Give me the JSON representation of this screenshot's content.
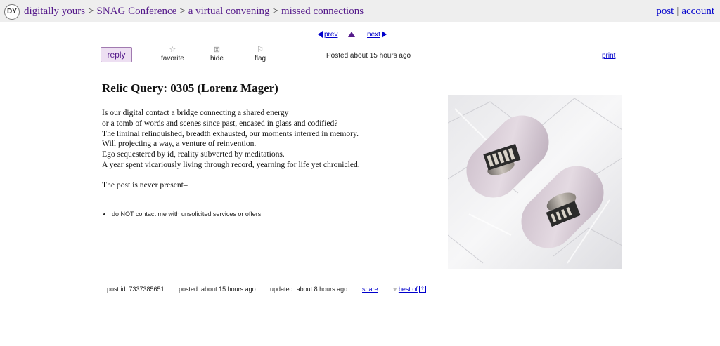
{
  "header": {
    "logo_text": "DY",
    "breadcrumbs": [
      "digitally yours",
      "SNAG Conference",
      "a virtual convening",
      "missed connections"
    ],
    "separator": ">",
    "links": [
      "post",
      "account"
    ]
  },
  "nav": {
    "prev": "prev",
    "next": "next"
  },
  "actions": {
    "reply": "reply",
    "favorite": "favorite",
    "hide": "hide",
    "flag": "flag",
    "posted_label": "Posted",
    "posted_value": "about 15 hours ago",
    "print": "print"
  },
  "post": {
    "title": "Relic Query: 0305 (Lorenz Mager)",
    "lines": [
      "Is our digital contact a bridge connecting a shared energy",
      "or a tomb of words and scenes since past, encased in glass and codified?",
      "The liminal relinquished, breadth exhausted, our moments interred in memory.",
      "Will projecting a way, a venture of reinvention.",
      "Ego sequestered by id, reality subverted by meditations.",
      "A year spent vicariously living through record, yearning for life yet chronicled."
    ],
    "closing": "The post is never present–",
    "notice": "do NOT contact me with unsolicited services or offers"
  },
  "footer": {
    "post_id": "post id: 7337385651",
    "posted_label": "posted:",
    "posted_value": "about 15 hours ago",
    "updated_label": "updated:",
    "updated_value": "about 8 hours ago",
    "share": "share",
    "best_of": "best of",
    "help": "?"
  },
  "colors": {
    "link": "#0000cc",
    "visited": "#551a8b",
    "topbar": "#eeeeee"
  }
}
